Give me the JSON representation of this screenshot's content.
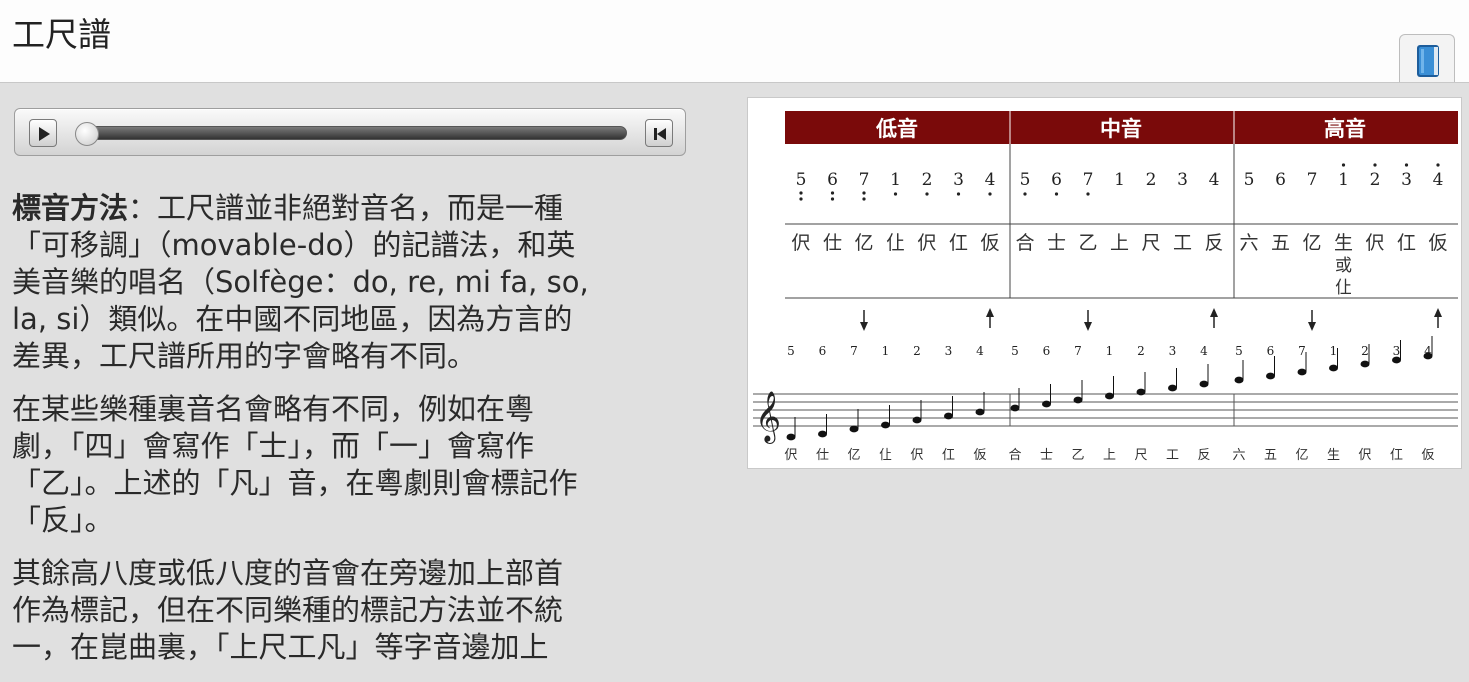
{
  "header": {
    "title": "工尺譜",
    "book_icon": "book-icon"
  },
  "audio_player": {
    "play_icon": "play-icon",
    "restart_icon": "skip-back-icon",
    "progress": 0
  },
  "article": {
    "p1_bold": "標音方法",
    "p1_lines": [
      "：工尺譜並非絕對音名，而是一種",
      "「可移調」（movable-do）的記譜法，和英",
      "美音樂的唱名（Solfège：do, re, mi fa, so,",
      "la, si）類似。在中國不同地區，因為方言的",
      "差異，工尺譜所用的字會略有不同。"
    ],
    "p2_lines": [
      "在某些樂種裏音名會略有不同，例如在粵",
      "劇，「四」會寫作「士」，而「一」會寫作",
      "「乙」。上述的「凡」音，在粵劇則會標記作",
      "「反」。"
    ],
    "p3_lines": [
      "其餘高八度或低八度的音會在旁邊加上部首",
      "作為標記，但在不同樂種的標記方法並不統",
      "一，在崑曲裏，「上尺工凡」等字音邊加上"
    ]
  },
  "figure": {
    "header_color": "#7a0a0a",
    "sections": [
      "低音",
      "中音",
      "高音"
    ],
    "digits": [
      "5",
      "6",
      "7",
      "1",
      "2",
      "3",
      "4",
      "5",
      "6",
      "7",
      "1",
      "2",
      "3",
      "4",
      "5",
      "6",
      "7",
      "1",
      "2",
      "3",
      "4"
    ],
    "characters": [
      "伬",
      "仕",
      "亿",
      "仩",
      "伬",
      "仜",
      "仮",
      "合",
      "士",
      "乙",
      "上",
      "尺",
      "工",
      "反",
      "六",
      "五",
      "亿",
      "生",
      "伬",
      "仜",
      "仮"
    ],
    "alt_char_or": "或",
    "alt_char": "仩",
    "bottom_characters": [
      "伬",
      "仕",
      "亿",
      "仩",
      "伬",
      "仜",
      "仮",
      "合",
      "士",
      "乙",
      "上",
      "尺",
      "工",
      "反",
      "六",
      "五",
      "亿",
      "生",
      "伬",
      "仜",
      "仮"
    ]
  }
}
